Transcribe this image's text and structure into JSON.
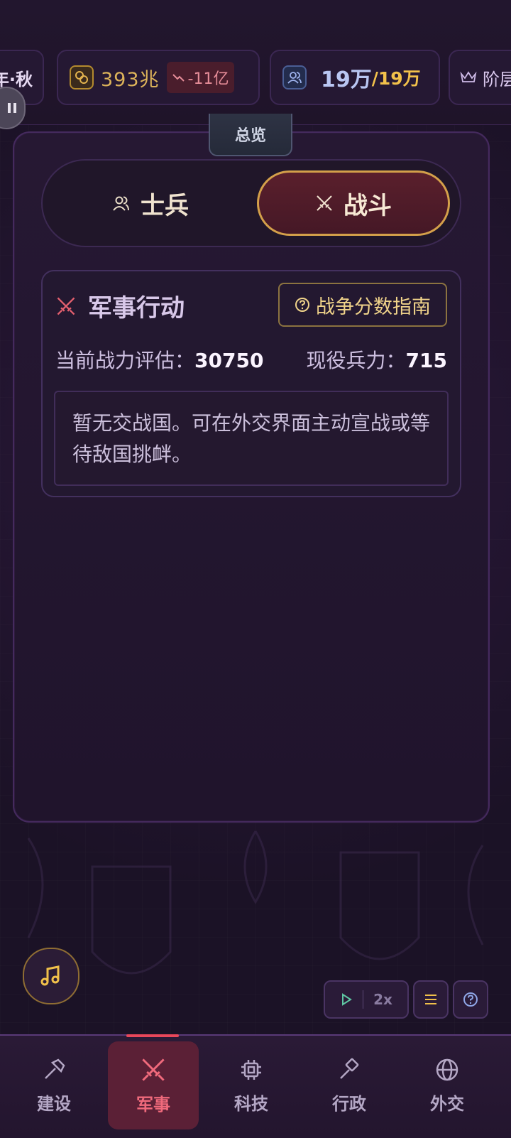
{
  "resources": {
    "season": "年·秋",
    "gold": "393兆",
    "gold_delta": "-11亿",
    "population": "19万",
    "population_max": "/19万",
    "rank_label": "阶层"
  },
  "panel": {
    "overview_tab": "总览",
    "tabs": [
      {
        "label": "士兵",
        "active": false
      },
      {
        "label": "战斗",
        "active": true
      }
    ],
    "military_ops": {
      "title": "军事行动",
      "guide_button": "战争分数指南",
      "power_label": "当前战力评估：",
      "power_value": "30750",
      "troops_label": "现役兵力：",
      "troops_value": "715",
      "notice": "暂无交战国。可在外交界面主动宣战或等待敌国挑衅。"
    }
  },
  "controls": {
    "speed": "2x"
  },
  "bottom_nav": [
    {
      "label": "建设",
      "icon": "hammer-icon",
      "active": false
    },
    {
      "label": "军事",
      "icon": "crossed-swords-icon",
      "active": true
    },
    {
      "label": "科技",
      "icon": "chip-icon",
      "active": false
    },
    {
      "label": "行政",
      "icon": "gavel-icon",
      "active": false
    },
    {
      "label": "外交",
      "icon": "globe-icon",
      "active": false
    }
  ],
  "colors": {
    "background": "#1b1226",
    "accent_gold": "#d4a04a",
    "accent_red": "#e8475a"
  }
}
